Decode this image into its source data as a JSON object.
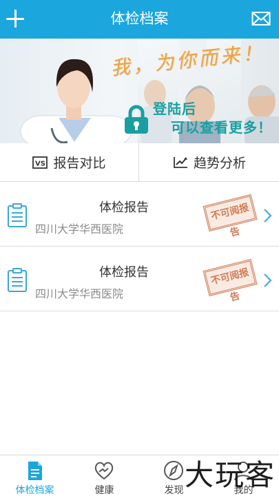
{
  "header": {
    "title": "体检档案",
    "add_icon": "plus-icon",
    "mail_icon": "mail-icon"
  },
  "banner": {
    "slogan": "我，为你而来！",
    "login_line1": "登陆后",
    "login_line2": "可以查看更多！",
    "lock_icon": "lock-icon"
  },
  "tabs": [
    {
      "label": "报告对比",
      "icon": "vs-icon"
    },
    {
      "label": "趋势分析",
      "icon": "trend-chart-icon"
    }
  ],
  "reports": [
    {
      "title": "体检报告",
      "hospital": "四川大学华西医院",
      "stamp": "不可阅报告"
    },
    {
      "title": "体检报告",
      "hospital": "四川大学华西医院",
      "stamp": "不可阅报告"
    }
  ],
  "bottom_nav": [
    {
      "label": "体检档案",
      "icon": "document-icon",
      "active": true
    },
    {
      "label": "健康",
      "icon": "heart-hand-icon",
      "active": false
    },
    {
      "label": "发现",
      "icon": "compass-icon",
      "active": false
    },
    {
      "label": "我的",
      "icon": "person-icon",
      "active": false
    }
  ],
  "watermark": "大玩客",
  "colors": {
    "primary": "#1ba6dd",
    "teal": "#1a9fa0",
    "stamp": "#c8653a",
    "slogan": "#f0a23c"
  }
}
